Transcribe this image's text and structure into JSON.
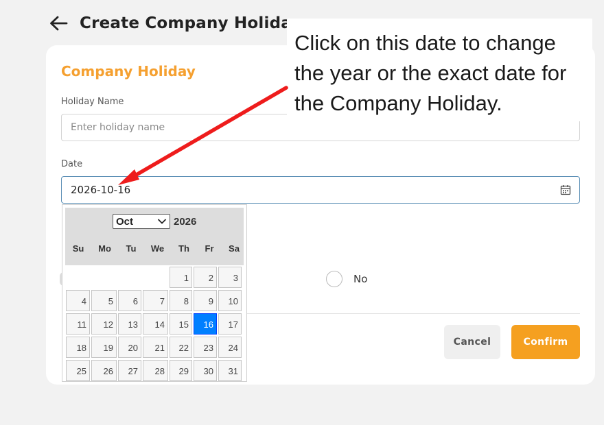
{
  "header": {
    "title": "Create Company Holiday",
    "back_icon": "arrow-left-icon"
  },
  "form": {
    "section_title": "Company Holiday",
    "holiday_name": {
      "label": "Holiday Name",
      "placeholder": "Enter holiday name",
      "value": ""
    },
    "date": {
      "label": "Date",
      "value": "2026-10-16",
      "icon": "calendar-icon"
    },
    "radio_no_label": "No",
    "cancel_label": "Cancel",
    "confirm_label": "Confirm"
  },
  "datepicker": {
    "month": "Oct",
    "year": "2026",
    "weekdays": [
      "Su",
      "Mo",
      "Tu",
      "We",
      "Th",
      "Fr",
      "Sa"
    ],
    "days": [
      "",
      "",
      "",
      "",
      "1",
      "2",
      "3",
      "4",
      "5",
      "6",
      "7",
      "8",
      "9",
      "10",
      "11",
      "12",
      "13",
      "14",
      "15",
      "16",
      "17",
      "18",
      "19",
      "20",
      "21",
      "22",
      "23",
      "24",
      "25",
      "26",
      "27",
      "28",
      "29",
      "30",
      "31"
    ],
    "selected_day": "16"
  },
  "annotation": {
    "text": "Click on this date to change the year or the exact date for the Company Holiday.",
    "line1": "Click on this date to change",
    "line2": "the year or the exact date for",
    "line3": "the Company Holiday.",
    "arrow_color": "#ee1c1c"
  },
  "colors": {
    "accent": "#f5a020",
    "section_title": "#f5a030",
    "selected_day": "#007fff"
  }
}
